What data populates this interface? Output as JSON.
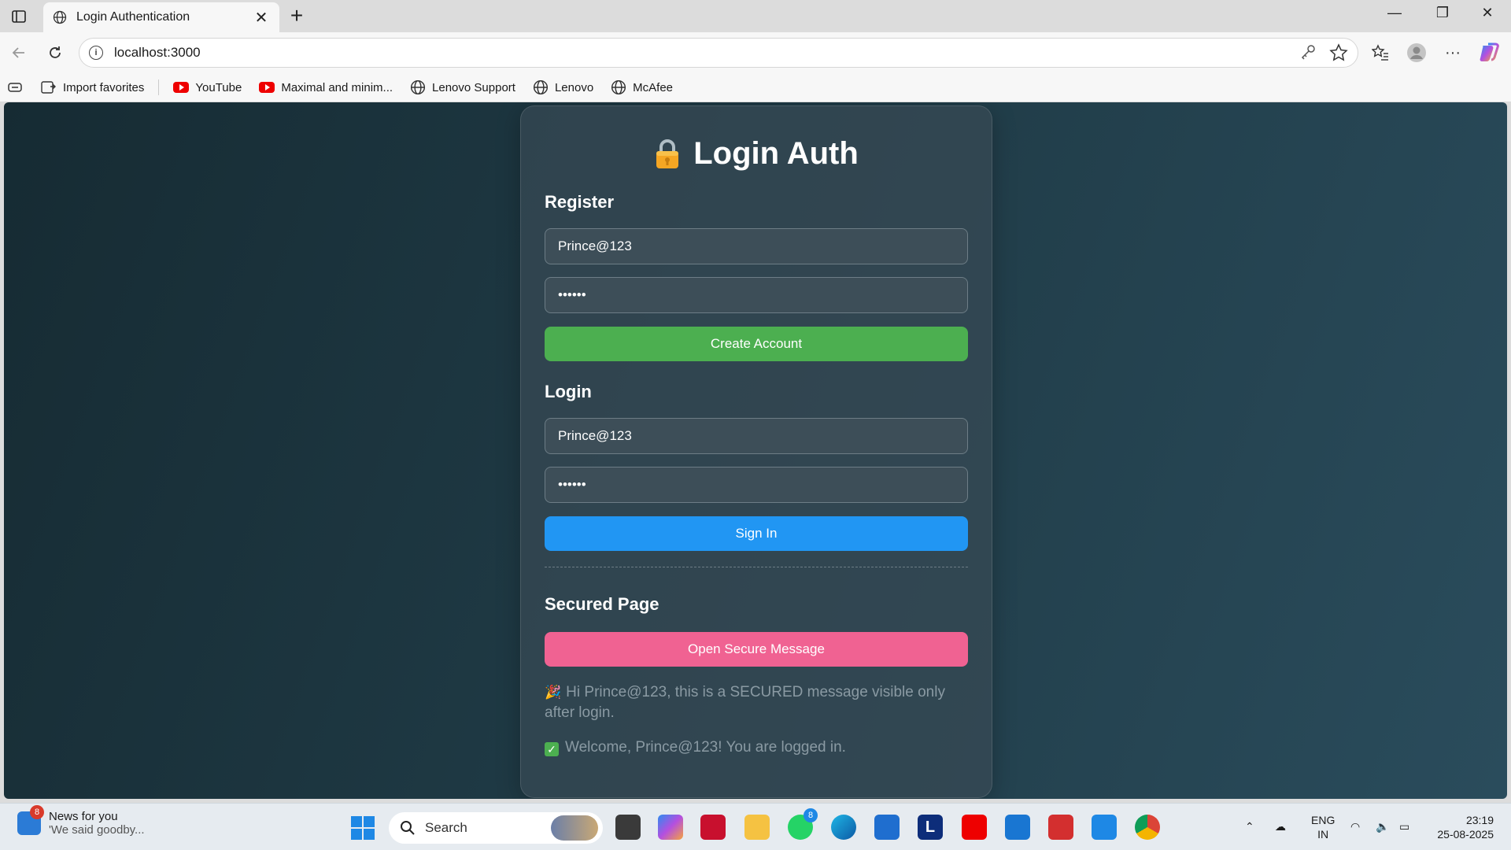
{
  "browser": {
    "tab_title": "Login Authentication",
    "url": "localhost:3000",
    "favorites": [
      {
        "label": "Import favorites",
        "icon": "import-icon"
      },
      {
        "label": "YouTube",
        "icon": "youtube-icon"
      },
      {
        "label": "Maximal and minim...",
        "icon": "youtube-icon"
      },
      {
        "label": "Lenovo Support",
        "icon": "globe-icon"
      },
      {
        "label": "Lenovo",
        "icon": "globe-icon"
      },
      {
        "label": "McAfee",
        "icon": "globe-icon"
      }
    ]
  },
  "page": {
    "title": "Login Auth",
    "register": {
      "heading": "Register",
      "username_value": "Prince@123",
      "password_value": "••••••",
      "button": "Create Account"
    },
    "login": {
      "heading": "Login",
      "username_value": "Prince@123",
      "password_value": "••••••",
      "button": "Sign In"
    },
    "secured": {
      "heading": "Secured Page",
      "button": "Open Secure Message",
      "message": "Hi Prince@123, this is a SECURED message visible only after login.",
      "status": "Welcome, Prince@123! You are logged in."
    },
    "colors": {
      "create_account": "#4caf50",
      "sign_in": "#2196f3",
      "secure_message": "#f06292"
    }
  },
  "taskbar": {
    "news_title": "News for you",
    "news_subtitle": "'We said goodby...",
    "news_badge": "8",
    "search_placeholder": "Search",
    "whatsapp_badge": "8",
    "lang_top": "ENG",
    "lang_bottom": "IN",
    "time": "23:19",
    "date": "25-08-2025"
  }
}
